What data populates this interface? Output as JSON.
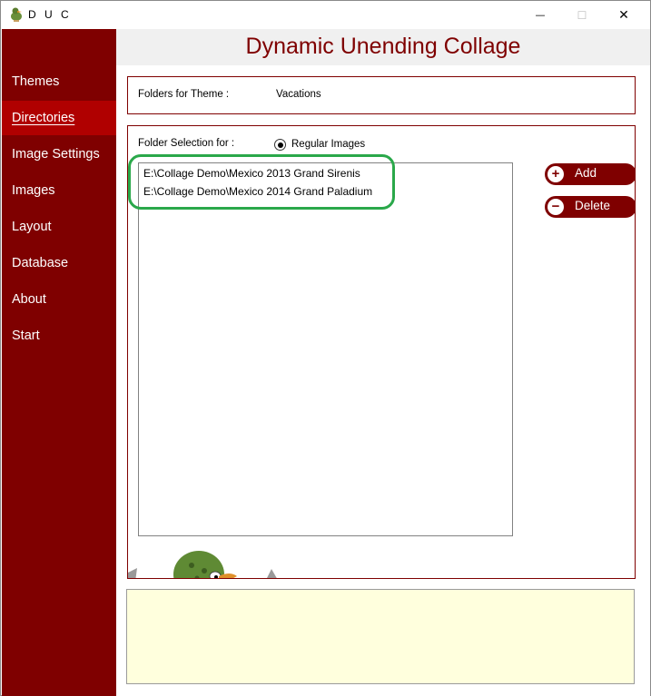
{
  "window": {
    "title": "D U C",
    "controls": {
      "minimize": "—",
      "maximize": "☐",
      "close": "✕"
    }
  },
  "sidebar": {
    "items": [
      {
        "label": "Themes",
        "active": false
      },
      {
        "label": "Directories",
        "active": true
      },
      {
        "label": "Image Settings",
        "active": false
      },
      {
        "label": "Images",
        "active": false
      },
      {
        "label": "Layout",
        "active": false
      },
      {
        "label": "Database",
        "active": false
      },
      {
        "label": "About",
        "active": false
      },
      {
        "label": "Start",
        "active": false
      }
    ]
  },
  "header": {
    "title": "Dynamic Unending Collage"
  },
  "theme": {
    "label": "Folders for Theme :",
    "value": "Vacations"
  },
  "directories": {
    "selection_label": "Folder Selection for :",
    "radio_label": "Regular Images",
    "folders": [
      "E:\\Collage Demo\\Mexico 2013 Grand Sirenis",
      "E:\\Collage Demo\\Mexico 2014 Grand Paladium"
    ],
    "add_label": "Add",
    "delete_label": "Delete",
    "add_icon": "+",
    "delete_icon": "−"
  },
  "colors": {
    "brand": "#7f0000",
    "active_nav": "#b00000",
    "highlight": "#2aa84a",
    "status_bg": "#ffffdd"
  }
}
